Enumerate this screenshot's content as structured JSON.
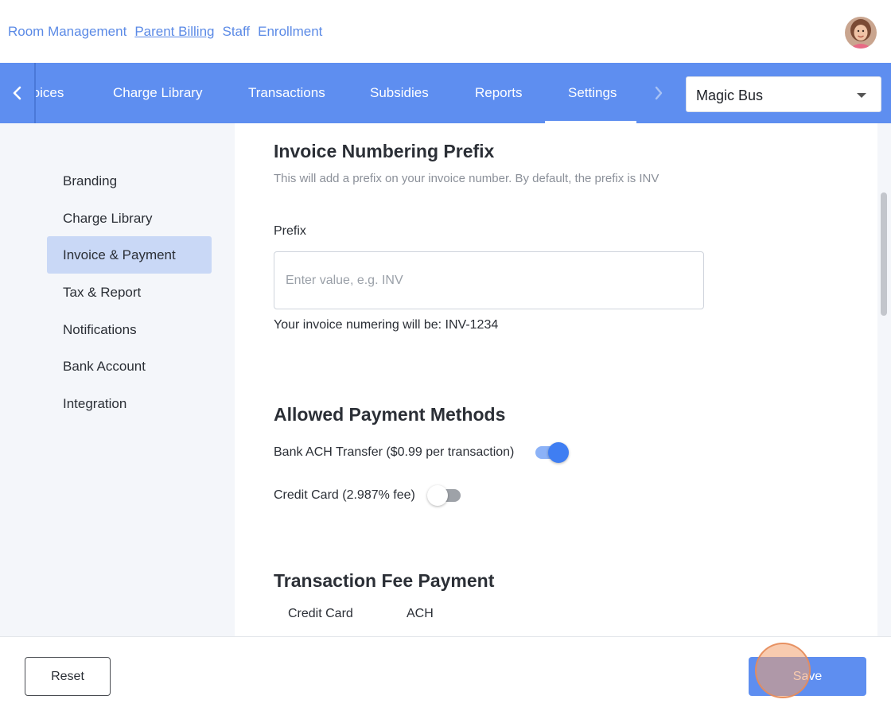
{
  "topnav": {
    "links": [
      "Room Management",
      "Parent Billing",
      "Staff",
      "Enrollment"
    ],
    "active_index": 1
  },
  "tabbar": {
    "tabs": [
      "Invoices",
      "Charge Library",
      "Transactions",
      "Subsidies",
      "Reports",
      "Settings"
    ],
    "active": "Settings",
    "school_select": {
      "selected": "Magic Bus"
    }
  },
  "sidebar": {
    "items": [
      "Branding",
      "Charge Library",
      "Invoice & Payment",
      "Tax & Report",
      "Notifications",
      "Bank Account",
      "Integration"
    ],
    "active": "Invoice & Payment"
  },
  "invoice_prefix": {
    "title": "Invoice Numbering Prefix",
    "description": "This will add a prefix on your invoice number. By default, the prefix is INV",
    "field_label": "Prefix",
    "placeholder": "Enter value, e.g. INV",
    "value": "",
    "preview": "Your invoice numering will be: INV-1234"
  },
  "payment_methods": {
    "title": "Allowed Payment Methods",
    "methods": [
      {
        "label": "Bank ACH Transfer ($0.99 per transaction)",
        "enabled": true
      },
      {
        "label": "Credit Card (2.987% fee)",
        "enabled": false
      }
    ]
  },
  "transaction_fee": {
    "title": "Transaction Fee Payment",
    "tabs": [
      "Credit Card",
      "ACH"
    ]
  },
  "footer": {
    "reset_label": "Reset",
    "save_label": "Save"
  },
  "colors": {
    "brand_blue": "#5e8ef0",
    "link_blue": "#5b8ae6",
    "sidebar_active": "#c9d8f6",
    "toggle_on": "#3f7ef2"
  },
  "icons": [
    "chevron-left-icon",
    "chevron-right-icon",
    "dropdown-caret-icon",
    "user-avatar"
  ]
}
